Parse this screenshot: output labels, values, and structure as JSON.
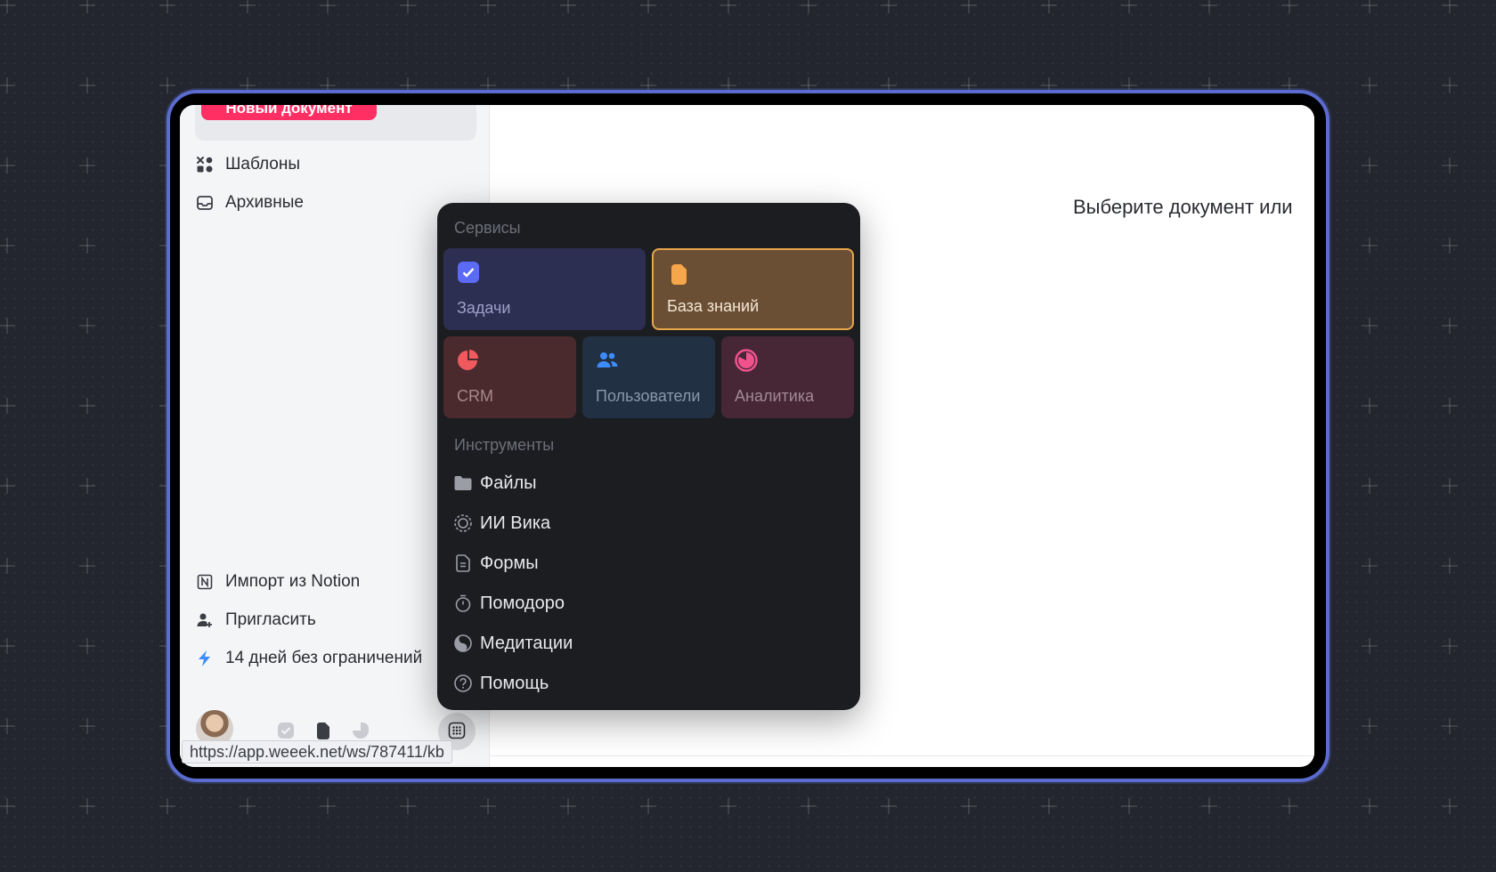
{
  "sidebar": {
    "new_doc_label": "Новый документ",
    "items": [
      {
        "label": "Шаблоны",
        "icon": "templates-icon"
      },
      {
        "label": "Архивные",
        "icon": "archive-icon"
      }
    ],
    "bottom_items": [
      {
        "label": "Импорт из Notion",
        "icon": "notion-icon"
      },
      {
        "label": "Пригласить",
        "icon": "invite-user-icon"
      },
      {
        "label": "14 дней без ограничений",
        "icon": "lightning-icon"
      }
    ]
  },
  "content": {
    "message": "Выберите документ или"
  },
  "status_url": "https://app.weeek.net/ws/787411/kb",
  "popup": {
    "services_title": "Сервисы",
    "tools_title": "Инструменты",
    "services": [
      {
        "label": "Задачи",
        "icon": "checkbox-icon",
        "color": "#2c2f52"
      },
      {
        "label": "База знаний",
        "icon": "document-icon",
        "color": "#6b4f34",
        "active": true
      },
      {
        "label": "CRM",
        "icon": "pie-chart-icon",
        "color": "#4a2a2d"
      },
      {
        "label": "Пользователи",
        "icon": "users-icon",
        "color": "#213043"
      },
      {
        "label": "Аналитика",
        "icon": "analytics-icon",
        "color": "#472636"
      }
    ],
    "tools": [
      {
        "label": "Файлы",
        "icon": "folder-icon"
      },
      {
        "label": "ИИ Вика",
        "icon": "ai-icon"
      },
      {
        "label": "Формы",
        "icon": "form-icon"
      },
      {
        "label": "Помодоро",
        "icon": "timer-icon"
      },
      {
        "label": "Медитации",
        "icon": "meditation-icon"
      },
      {
        "label": "Помощь",
        "icon": "help-icon"
      }
    ]
  },
  "colors": {
    "accent": "#ff2e63",
    "frame": "#5b6bd0",
    "active_border": "#e8a54b"
  }
}
